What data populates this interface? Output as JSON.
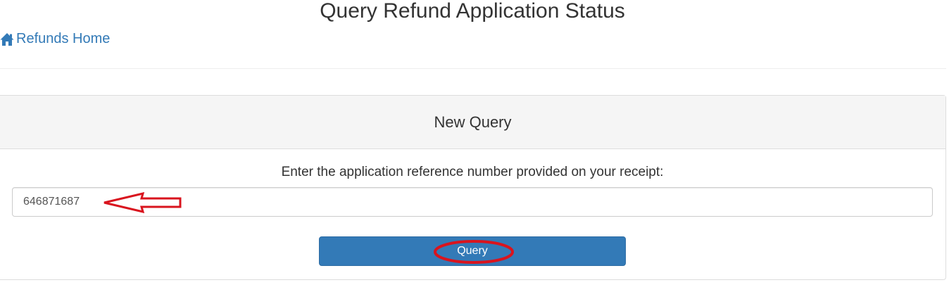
{
  "header": {
    "title": "Query Refund Application Status"
  },
  "nav": {
    "home_icon": "home-icon",
    "home_label": "Refunds Home"
  },
  "panel": {
    "heading": "New Query",
    "field_label": "Enter the application reference number provided on your receipt:",
    "reference_value": "646871687",
    "query_button_label": "Query"
  },
  "annotations": {
    "arrow_icon": "left-arrow-annotation",
    "circle_icon": "ellipse-annotation",
    "color": "#d9141e"
  },
  "colors": {
    "link": "#337ab7",
    "button_bg": "#337ab7",
    "panel_heading_bg": "#f5f5f5"
  }
}
